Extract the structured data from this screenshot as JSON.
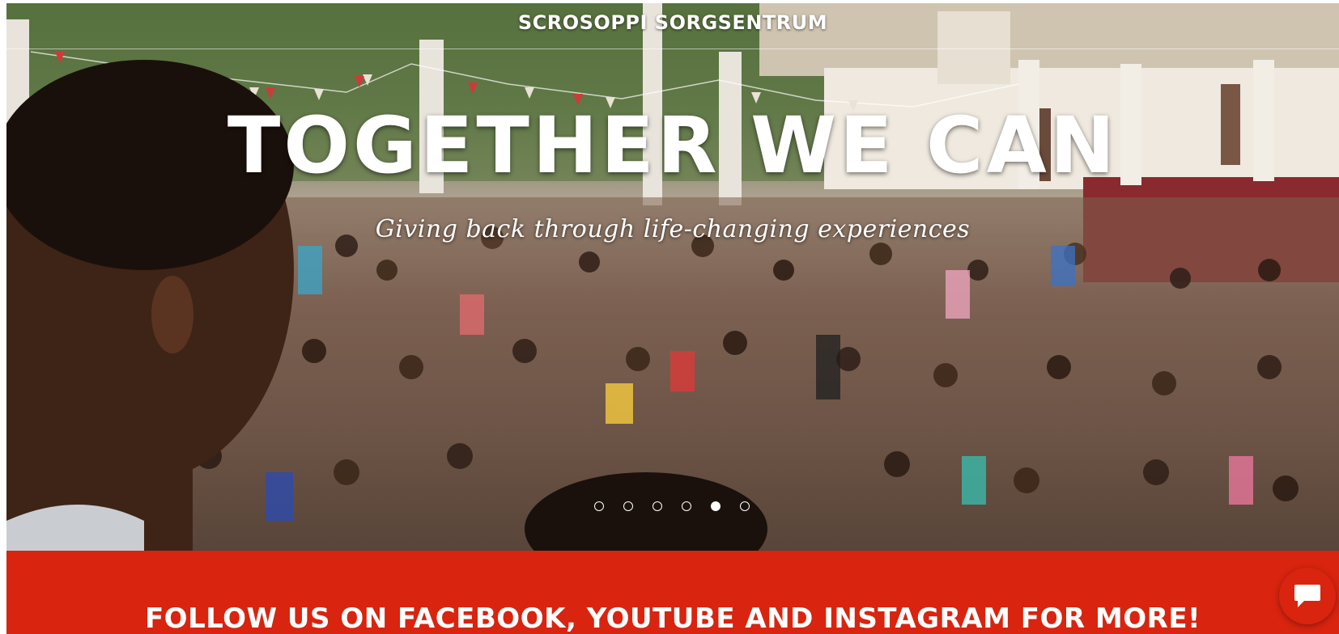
{
  "header": {
    "site_title": "SCROSOPPI SORGSENTRUM"
  },
  "hero": {
    "headline": "TOGETHER WE CAN",
    "subline": "Giving back through life-changing experiences",
    "carousel": {
      "slide_count": 6,
      "active_index": 4
    }
  },
  "banner": {
    "text": "FOLLOW US ON FACEBOOK, YOUTUBE AND INSTAGRAM FOR MORE!",
    "color": "#d9240f"
  },
  "chat": {
    "icon": "chat-bubble-icon"
  }
}
